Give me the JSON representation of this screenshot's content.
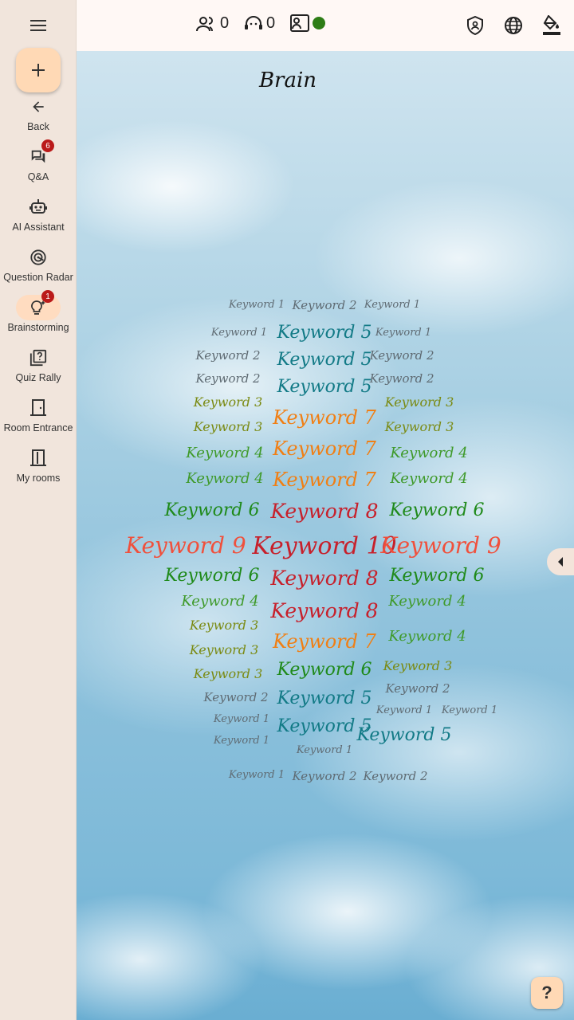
{
  "nav": {
    "items": [
      {
        "label": "Back",
        "icon": "arrow-back-icon"
      },
      {
        "label": "Q&A",
        "icon": "forum-icon",
        "badge": "6"
      },
      {
        "label": "AI Assistant",
        "icon": "robot-icon"
      },
      {
        "label": "Question Radar",
        "icon": "radar-icon"
      },
      {
        "label": "Brainstorming",
        "icon": "lightbulb-icon",
        "badge": "1",
        "active": true
      },
      {
        "label": "Quiz Rally",
        "icon": "quiz-icon"
      },
      {
        "label": "Room Entrance",
        "icon": "door-icon"
      },
      {
        "label": "My rooms",
        "icon": "rooms-icon"
      }
    ]
  },
  "topbar": {
    "participants": "0",
    "moderators": "0",
    "presenter_status_color": "#2e7d16",
    "presenter_count": ""
  },
  "main": {
    "title": "Brain",
    "help_label": "?"
  },
  "colors": {
    "level1": "#5f6b73",
    "level2": "#5f6b73",
    "level3": "#7a8a12",
    "level4": "#3f9a2a",
    "level5": "#127a86",
    "level6": "#1f8a1a",
    "level7": "#f07f14",
    "level8": "#c7202b",
    "level9": "#f0503c",
    "level10": "#c7202b",
    "accent": "#ffd9b5"
  },
  "words": [
    {
      "text": "Keyword 1",
      "level": 1
    },
    {
      "text": "Keyword 2",
      "level": 2
    },
    {
      "text": "Keyword 1",
      "level": 1
    },
    {
      "text": "Keyword 1",
      "level": 1
    },
    {
      "text": "Keyword 5",
      "level": 5
    },
    {
      "text": "Keyword 1",
      "level": 1
    },
    {
      "text": "Keyword 2",
      "level": 2
    },
    {
      "text": "Keyword 5",
      "level": 5
    },
    {
      "text": "Keyword 2",
      "level": 2
    },
    {
      "text": "Keyword 2",
      "level": 2
    },
    {
      "text": "Keyword 5",
      "level": 5
    },
    {
      "text": "Keyword 2",
      "level": 2
    },
    {
      "text": "Keyword 3",
      "level": 3
    },
    {
      "text": "Keyword 7",
      "level": 7
    },
    {
      "text": "Keyword 3",
      "level": 3
    },
    {
      "text": "Keyword 3",
      "level": 3
    },
    {
      "text": "Keyword 3",
      "level": 3
    },
    {
      "text": "Keyword 4",
      "level": 4
    },
    {
      "text": "Keyword 7",
      "level": 7
    },
    {
      "text": "Keyword 4",
      "level": 4
    },
    {
      "text": "Keyword 4",
      "level": 4
    },
    {
      "text": "Keyword 7",
      "level": 7
    },
    {
      "text": "Keyword 4",
      "level": 4
    },
    {
      "text": "Keyword 6",
      "level": 6
    },
    {
      "text": "Keyword 8",
      "level": 8
    },
    {
      "text": "Keyword 6",
      "level": 6
    },
    {
      "text": "Keyword 9",
      "level": 9
    },
    {
      "text": "Keyword 10",
      "level": 10
    },
    {
      "text": "Keyword 9",
      "level": 9
    },
    {
      "text": "Keyword 6",
      "level": 6
    },
    {
      "text": "Keyword 8",
      "level": 8
    },
    {
      "text": "Keyword 6",
      "level": 6
    },
    {
      "text": "Keyword 4",
      "level": 4
    },
    {
      "text": "Keyword 8",
      "level": 8
    },
    {
      "text": "Keyword 4",
      "level": 4
    },
    {
      "text": "Keyword 3",
      "level": 3
    },
    {
      "text": "Keyword 3",
      "level": 3
    },
    {
      "text": "Keyword 7",
      "level": 7
    },
    {
      "text": "Keyword 4",
      "level": 4
    },
    {
      "text": "Keyword 3",
      "level": 3
    },
    {
      "text": "Keyword 6",
      "level": 6
    },
    {
      "text": "Keyword 3",
      "level": 3
    },
    {
      "text": "Keyword 2",
      "level": 2
    },
    {
      "text": "Keyword 5",
      "level": 5
    },
    {
      "text": "Keyword 2",
      "level": 2
    },
    {
      "text": "Keyword 1",
      "level": 1
    },
    {
      "text": "Keyword 5",
      "level": 5
    },
    {
      "text": "Keyword 1",
      "level": 1
    },
    {
      "text": "Keyword 1",
      "level": 1
    },
    {
      "text": "Keyword 1",
      "level": 1
    },
    {
      "text": "Keyword 1",
      "level": 1
    },
    {
      "text": "Keyword 5",
      "level": 5
    },
    {
      "text": "Keyword 1",
      "level": 1
    },
    {
      "text": "Keyword 2",
      "level": 2
    },
    {
      "text": "Keyword 2",
      "level": 2
    }
  ]
}
